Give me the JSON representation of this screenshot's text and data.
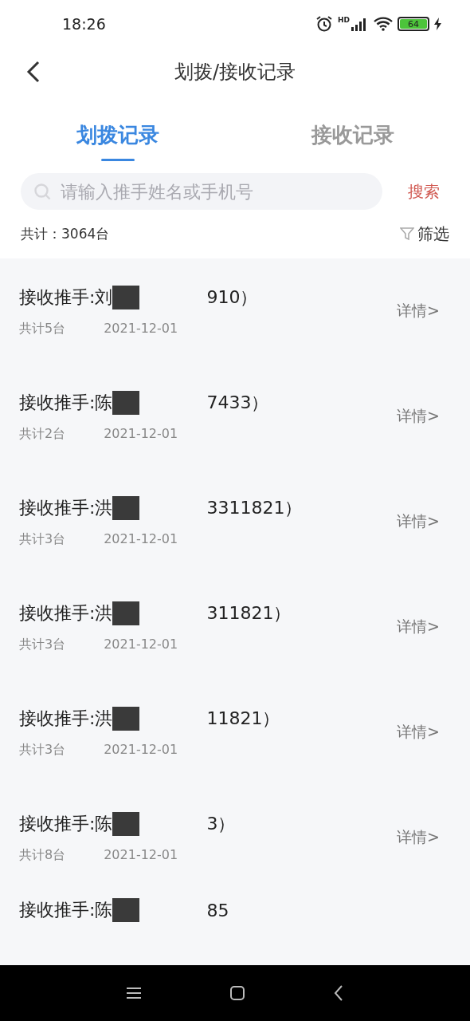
{
  "status_bar": {
    "time": "18:26",
    "network_label": "HD",
    "battery": "64"
  },
  "header": {
    "title": "划拨/接收记录"
  },
  "tabs": [
    {
      "label": "划拨记录",
      "selected": true
    },
    {
      "label": "接收记录",
      "selected": false
    }
  ],
  "search": {
    "placeholder": "请输入推手姓名或手机号",
    "button": "搜索"
  },
  "summary": {
    "total": "共计：3064台",
    "filter": "筛选"
  },
  "records": [
    {
      "receiver": "接收推手:刘",
      "tail": "910）",
      "count": "共计5台",
      "date": "2021-12-01",
      "link": "详情>"
    },
    {
      "receiver": "接收推手:陈",
      "tail": "7433）",
      "count": "共计2台",
      "date": "2021-12-01",
      "link": "详情>"
    },
    {
      "receiver": "接收推手:洪",
      "tail": "3311821）",
      "count": "共计3台",
      "date": "2021-12-01",
      "link": "详情>"
    },
    {
      "receiver": "接收推手:洪",
      "tail": "311821）",
      "count": "共计3台",
      "date": "2021-12-01",
      "link": "详情>"
    },
    {
      "receiver": "接收推手:洪",
      "tail": "11821）",
      "count": "共计3台",
      "date": "2021-12-01",
      "link": "详情>"
    },
    {
      "receiver": "接收推手:陈",
      "tail": "3）",
      "count": "共计8台",
      "date": "2021-12-01",
      "link": "详情>"
    },
    {
      "receiver": "接收推手:陈",
      "tail": "85"
    }
  ]
}
